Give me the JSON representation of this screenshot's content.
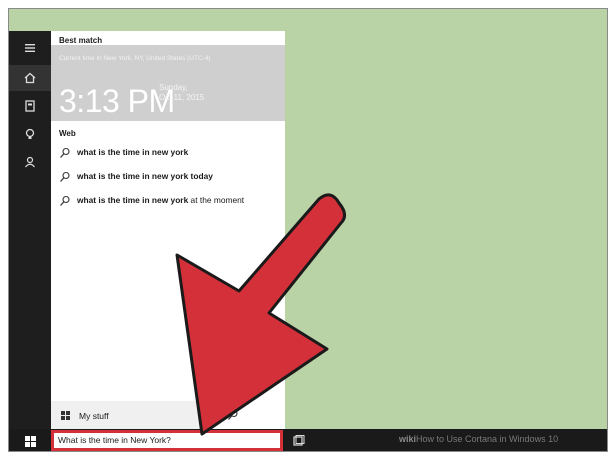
{
  "cortana": {
    "best_match_header": "Best match",
    "time_card": {
      "timezone_line": "Current time in New York, NY, United States (UTC-4)",
      "time": "3:13 PM",
      "day": "Sunday,",
      "date": "Oct 11, 2015"
    },
    "web_header": "Web",
    "web_results": [
      {
        "query": "what is the time in new york",
        "suffix": ""
      },
      {
        "query": "what is the time in new york today",
        "suffix": ""
      },
      {
        "query": "what is the time in new york",
        "suffix": " at the moment"
      }
    ],
    "my_stuff_label": "My stuff"
  },
  "taskbar": {
    "search_value": "What is the time in New York?",
    "watermark_brand": "wiki",
    "watermark_text": "How to Use Cortana in Windows 10"
  },
  "colors": {
    "desktop": "#b9d3a6",
    "rail": "#1e1e1e",
    "time_card": "#cfcfcf",
    "arrow_fill": "#d3303a",
    "search_border": "#d3303a"
  },
  "icons": [
    "hamburger-icon",
    "home-icon",
    "notebook-icon",
    "lightbulb-icon",
    "feedback-icon",
    "search-icon",
    "windows-logo-icon",
    "task-view-icon"
  ]
}
